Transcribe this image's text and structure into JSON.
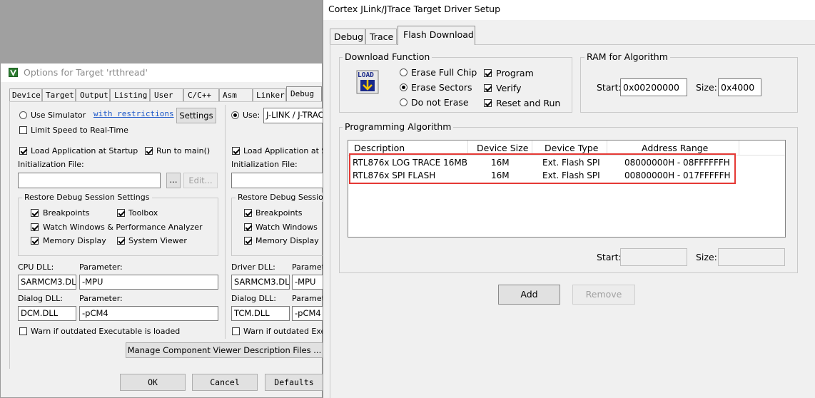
{
  "options": {
    "title": "Options for Target 'rtthread'",
    "tabs": [
      "Device",
      "Target",
      "Output",
      "Listing",
      "User",
      "C/C++",
      "Asm",
      "Linker",
      "Debug"
    ],
    "left": {
      "use_simulator": "Use Simulator",
      "with_restrictions": "with restrictions",
      "settings": "Settings",
      "limit_speed": "Limit Speed to Real-Time",
      "load_app": "Load Application at Startup",
      "run_to_main": "Run to main()",
      "init_file": "Initialization File:",
      "browse": "...",
      "edit": "Edit...",
      "restore_group": "Restore Debug Session Settings",
      "breakpoints": "Breakpoints",
      "toolbox": "Toolbox",
      "watch": "Watch Windows & Performance Analyzer",
      "memory": "Memory Display",
      "sysviewer": "System Viewer",
      "cpu_dll_label": "CPU DLL:",
      "param_label": "Parameter:",
      "cpu_dll": "SARMCM3.DLL",
      "cpu_param": "-MPU",
      "dialog_dll_label": "Dialog DLL:",
      "dialog_dll": "DCM.DLL",
      "dialog_param": "-pCM4",
      "warn": "Warn if outdated Executable is loaded"
    },
    "right": {
      "use": "Use:",
      "driver": "J-LINK / J-TRACE",
      "load_app": "Load Application at Sta",
      "init_file": "Initialization File:",
      "restore_group": "Restore Debug Session",
      "breakpoints": "Breakpoints",
      "watch": "Watch Windows",
      "memory": "Memory Display",
      "driver_dll_label": "Driver DLL:",
      "param_label": "Paramete",
      "driver_dll": "SARMCM3.DLL",
      "driver_param": "-MPU",
      "dialog_dll_label": "Dialog DLL:",
      "dialog_param_label": "Paramete",
      "dialog_dll": "TCM.DLL",
      "dialog_param": "-pCM4",
      "warn": "Warn if outdated Execu"
    },
    "manage": "Manage Component Viewer Description Files ...",
    "ok": "OK",
    "cancel": "Cancel",
    "defaults": "Defaults"
  },
  "setup": {
    "title": "Cortex JLink/JTrace Target Driver Setup",
    "tabs": [
      "Debug",
      "Trace",
      "Flash Download"
    ],
    "download_function": "Download Function",
    "load_icon_label": "LOAD",
    "erase_full": "Erase Full Chip",
    "erase_sectors": "Erase Sectors",
    "do_not_erase": "Do not Erase",
    "program": "Program",
    "verify": "Verify",
    "reset_run": "Reset and Run",
    "ram_group": "RAM for Algorithm",
    "start_label": "Start:",
    "start_value": "0x00200000",
    "size_label": "Size:",
    "size_value": "0x4000",
    "prog_algo": "Programming Algorithm",
    "columns": [
      "Description",
      "Device Size",
      "Device Type",
      "Address Range"
    ],
    "rows": [
      {
        "desc": "RTL876x LOG TRACE 16MB",
        "size": "16M",
        "type": "Ext. Flash SPI",
        "range": "08000000H - 08FFFFFFH"
      },
      {
        "desc": "RTL876x SPI FLASH",
        "size": "16M",
        "type": "Ext. Flash SPI",
        "range": "00800000H - 017FFFFFH"
      }
    ],
    "bottom_start": "Start:",
    "bottom_size": "Size:",
    "add": "Add",
    "remove": "Remove",
    "highlight_color": "#e53935"
  }
}
